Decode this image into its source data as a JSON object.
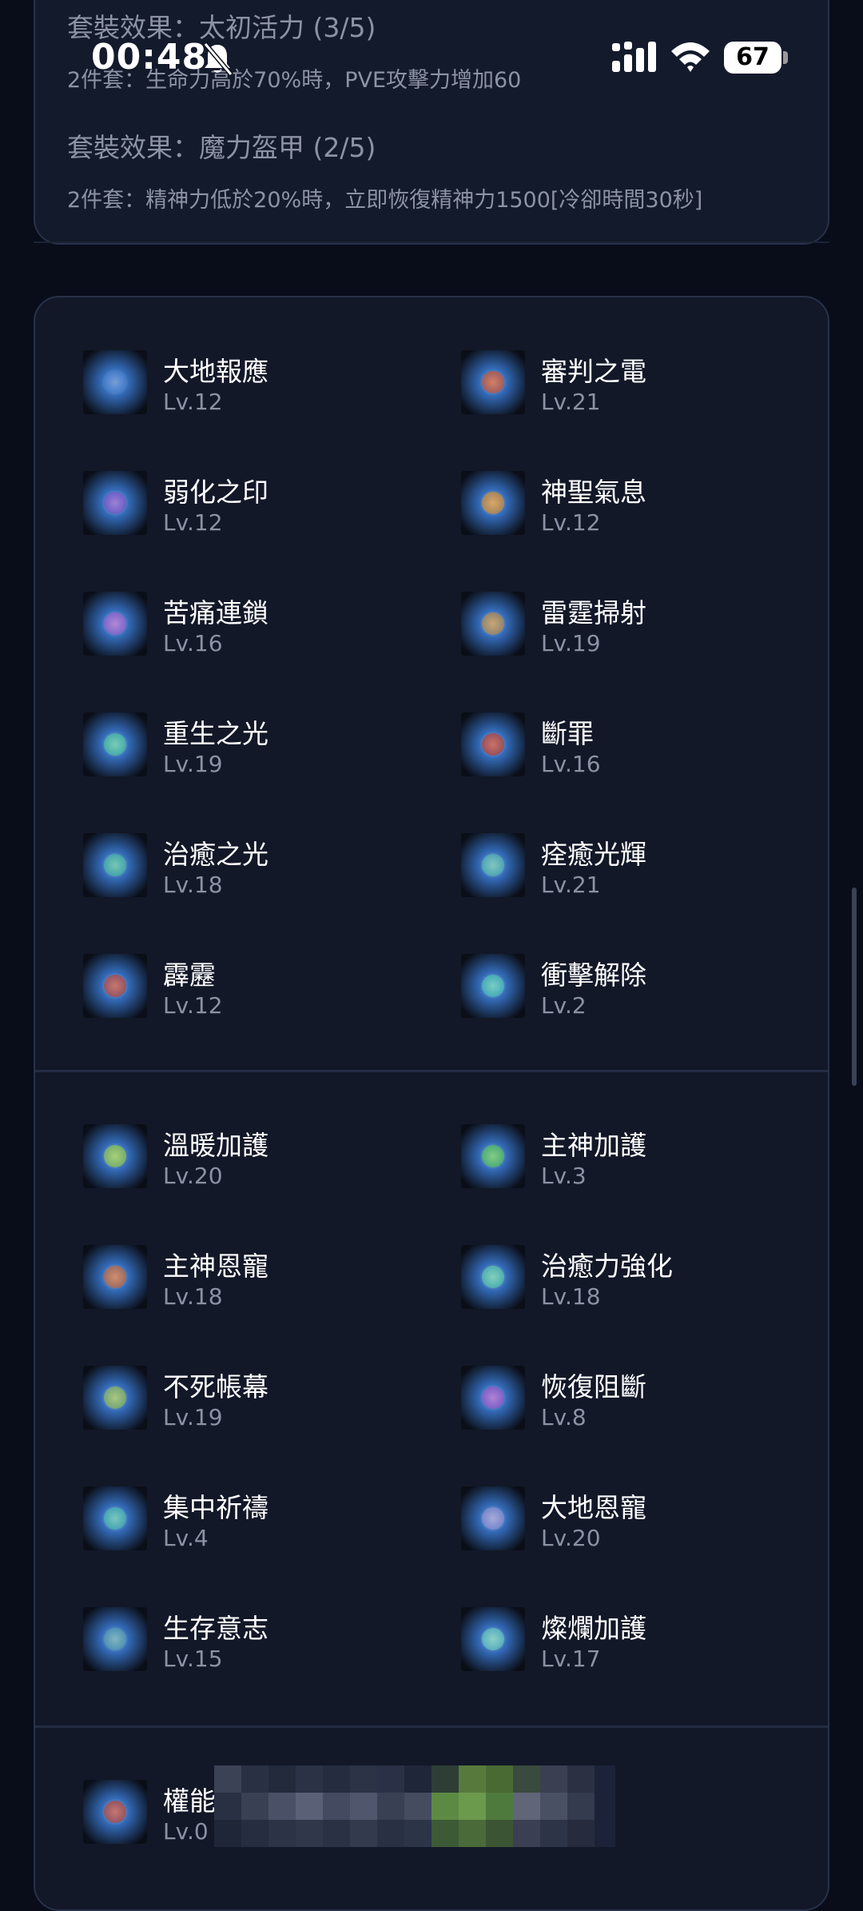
{
  "status_bar": {
    "time": "00:48",
    "battery": "67"
  },
  "set_effects": [
    {
      "title": "套裝效果：太初活力 (3/5)",
      "desc": "2件套：生命力高於70%時，PVE攻擊力增加60"
    },
    {
      "title": "套裝效果：魔力盔甲 (2/5)",
      "desc": "2件套：精神力低於20%時，立即恢復精神力1500[冷卻時間30秒]"
    }
  ],
  "active_skills": [
    {
      "name": "大地報應",
      "level": "Lv.12",
      "icon": "earth-retribution-icon",
      "color": "#3a7bd5"
    },
    {
      "name": "審判之電",
      "level": "Lv.21",
      "icon": "judgment-lightning-icon",
      "color": "#d4491f"
    },
    {
      "name": "弱化之印",
      "level": "Lv.12",
      "icon": "weaken-seal-icon",
      "color": "#7a4bd0"
    },
    {
      "name": "神聖氣息",
      "level": "Lv.12",
      "icon": "holy-aura-icon",
      "color": "#e08a1e"
    },
    {
      "name": "苦痛連鎖",
      "level": "Lv.16",
      "icon": "pain-chain-icon",
      "color": "#9b59d6"
    },
    {
      "name": "雷霆掃射",
      "level": "Lv.19",
      "icon": "thunder-sweep-icon",
      "color": "#c08a3a"
    },
    {
      "name": "重生之光",
      "level": "Lv.19",
      "icon": "rebirth-light-icon",
      "color": "#3fc9a0"
    },
    {
      "name": "斷罪",
      "level": "Lv.16",
      "icon": "condemn-icon",
      "color": "#c8321c"
    },
    {
      "name": "治癒之光",
      "level": "Lv.18",
      "icon": "healing-light-icon",
      "color": "#3cbfa0"
    },
    {
      "name": "痊癒光輝",
      "level": "Lv.21",
      "icon": "recovery-radiance-icon",
      "color": "#4fbfb0"
    },
    {
      "name": "霹靂",
      "level": "Lv.12",
      "icon": "thunderbolt-icon",
      "color": "#c23a2a"
    },
    {
      "name": "衝擊解除",
      "level": "Lv.2",
      "icon": "shock-release-icon",
      "color": "#3fc9b8"
    }
  ],
  "passive_skills": [
    {
      "name": "溫暖加護",
      "level": "Lv.20",
      "icon": "warm-blessing-icon",
      "color": "#8fcf3a"
    },
    {
      "name": "主神加護",
      "level": "Lv.3",
      "icon": "god-blessing-icon",
      "color": "#4fc94f"
    },
    {
      "name": "主神恩寵",
      "level": "Lv.18",
      "icon": "god-grace-icon",
      "color": "#d0602a"
    },
    {
      "name": "治癒力強化",
      "level": "Lv.18",
      "icon": "healing-boost-icon",
      "color": "#4fcfa8"
    },
    {
      "name": "不死帳幕",
      "level": "Lv.19",
      "icon": "undying-veil-icon",
      "color": "#8fc04a"
    },
    {
      "name": "恢復阻斷",
      "level": "Lv.8",
      "icon": "recovery-block-icon",
      "color": "#9a4fd0"
    },
    {
      "name": "集中祈禱",
      "level": "Lv.4",
      "icon": "focused-prayer-icon",
      "color": "#3fbfaf"
    },
    {
      "name": "大地恩寵",
      "level": "Lv.20",
      "icon": "earth-grace-icon",
      "color": "#8f8fd8"
    },
    {
      "name": "生存意志",
      "level": "Lv.15",
      "icon": "will-to-survive-icon",
      "color": "#4fa0b0"
    },
    {
      "name": "燦爛加護",
      "level": "Lv.17",
      "icon": "brilliant-blessing-icon",
      "color": "#5fd0c0"
    }
  ],
  "ultimate_skill": {
    "name": "權能",
    "level": "Lv.0",
    "icon": "authority-icon",
    "color": "#c03a2a"
  }
}
